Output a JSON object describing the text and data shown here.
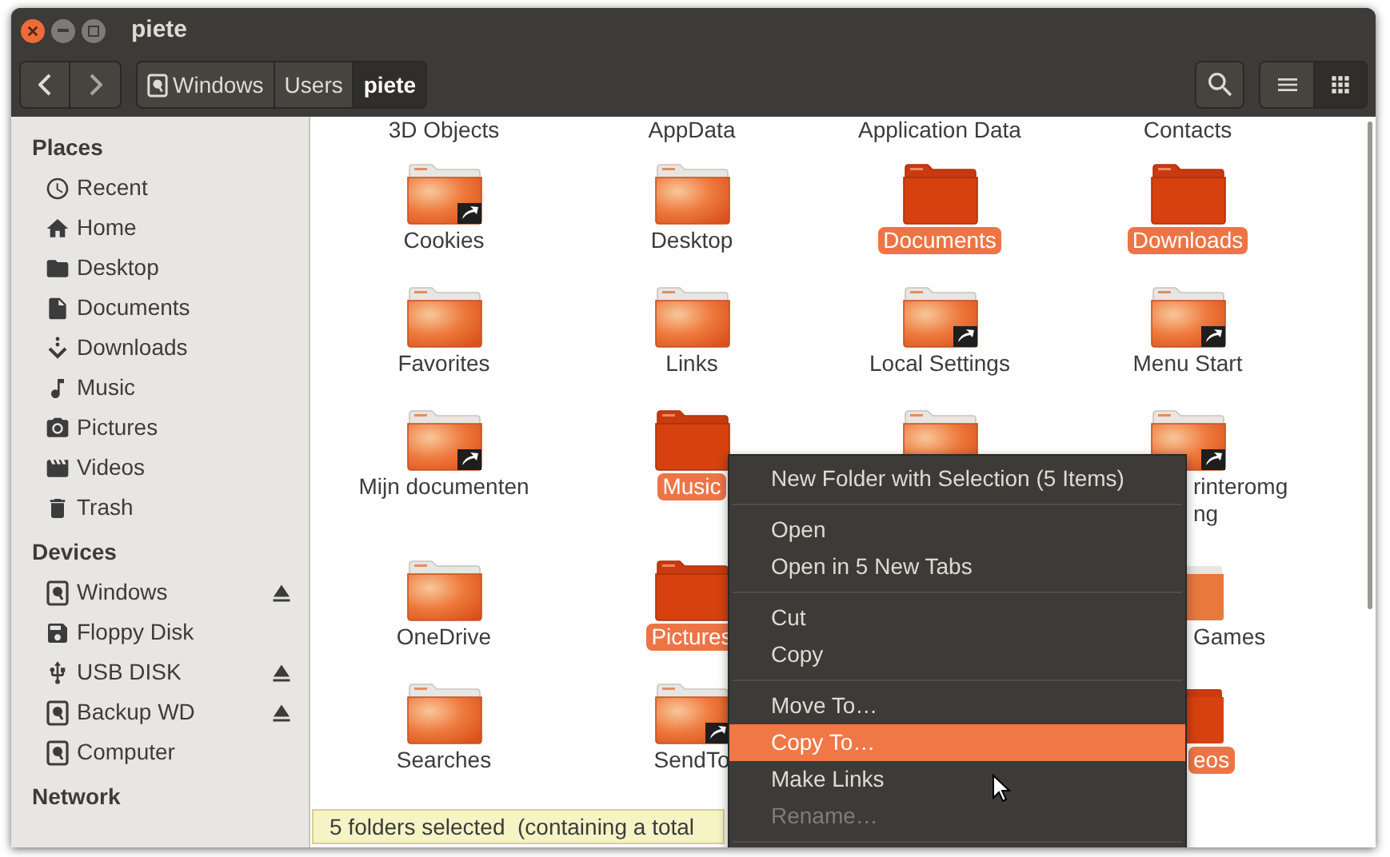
{
  "window": {
    "title": "piete"
  },
  "toolbar": {
    "breadcrumbs": [
      {
        "label": "Windows",
        "drive": true,
        "selected": false
      },
      {
        "label": "Users",
        "drive": false,
        "selected": false
      },
      {
        "label": "piete",
        "drive": false,
        "selected": true
      }
    ],
    "views": [
      {
        "kind": "list",
        "selected": false
      },
      {
        "kind": "grid",
        "selected": true
      }
    ]
  },
  "sidebar": [
    {
      "title": "Places",
      "items": [
        {
          "label": "Recent",
          "eject": false
        },
        {
          "label": "Home",
          "eject": false
        },
        {
          "label": "Desktop",
          "eject": false
        },
        {
          "label": "Documents",
          "eject": false
        },
        {
          "label": "Downloads",
          "eject": false
        },
        {
          "label": "Music",
          "eject": false
        },
        {
          "label": "Pictures",
          "eject": false
        },
        {
          "label": "Videos",
          "eject": false
        },
        {
          "label": "Trash",
          "eject": false
        }
      ]
    },
    {
      "title": "Devices",
      "items": [
        {
          "label": "Windows",
          "eject": true
        },
        {
          "label": "Floppy Disk",
          "eject": false
        },
        {
          "label": "USB DISK",
          "eject": true
        },
        {
          "label": "Backup WD",
          "eject": true
        },
        {
          "label": "Computer",
          "eject": false
        }
      ]
    },
    {
      "title": "Network"
    }
  ],
  "grid_rows": [
    [
      {
        "label": "3D Objects",
        "icon_visible": false,
        "selected": false,
        "clipped": false
      },
      {
        "label": "AppData",
        "icon_visible": false,
        "selected": false,
        "clipped": false
      },
      {
        "label": "Application Data",
        "icon_visible": false,
        "selected": false,
        "clipped": false
      },
      {
        "label": "Contacts",
        "icon_visible": false,
        "selected": false,
        "clipped": false
      }
    ],
    [
      {
        "label": "Cookies",
        "icon_visible": true,
        "link": true,
        "selected": false,
        "clipped": false
      },
      {
        "label": "Desktop",
        "icon_visible": true,
        "link": false,
        "selected": false,
        "clipped": false
      },
      {
        "label": "Documents",
        "icon_visible": true,
        "link": false,
        "selected": true,
        "clipped": false
      },
      {
        "label": "Downloads",
        "icon_visible": true,
        "link": false,
        "selected": true,
        "clipped": false
      }
    ],
    [
      {
        "label": "Favorites",
        "icon_visible": true,
        "link": false,
        "selected": false,
        "clipped": false
      },
      {
        "label": "Links",
        "icon_visible": true,
        "link": false,
        "selected": false,
        "clipped": false
      },
      {
        "label": "Local Settings",
        "icon_visible": true,
        "link": true,
        "selected": false,
        "clipped": false
      },
      {
        "label": "Menu Start",
        "icon_visible": true,
        "link": true,
        "selected": false,
        "clipped": false
      }
    ],
    [
      {
        "label": "Mijn documenten",
        "icon_visible": true,
        "link": true,
        "selected": false,
        "clipped": false
      },
      {
        "label": "Music",
        "icon_visible": true,
        "link": false,
        "selected": true,
        "clipped": false
      },
      {
        "icon_visible": true,
        "link": false,
        "clipped": false
      },
      {
        "label": "rinteromg\nng",
        "icon_visible": true,
        "link": true,
        "selected": false,
        "clipped": true
      }
    ],
    [
      {
        "label": "OneDrive",
        "icon_visible": true,
        "link": false,
        "selected": false,
        "clipped": false
      },
      {
        "label": "Pictures",
        "icon_visible": true,
        "link": false,
        "selected": true,
        "clipped": false
      },
      null,
      {
        "label": "Games",
        "icon_visible": true,
        "link": false,
        "selected": false,
        "clipped": true
      }
    ],
    [
      {
        "label": "Searches",
        "icon_visible": true,
        "link": false,
        "selected": false,
        "clipped": false
      },
      {
        "label": "SendTo",
        "icon_visible": true,
        "link": true,
        "selected": false,
        "clipped": false
      },
      null,
      {
        "label": "eos",
        "icon_visible": true,
        "link": false,
        "selected": true,
        "clipped": true
      }
    ]
  ],
  "status_bar": "5 folders selected  (containing a total",
  "context_menu": [
    {
      "kind": "item",
      "label": "New Folder with Selection (5 Items)",
      "selected": false,
      "disabled": false
    },
    {
      "kind": "separator"
    },
    {
      "kind": "item",
      "label": "Open",
      "selected": false,
      "disabled": false
    },
    {
      "kind": "item",
      "label": "Open in 5 New Tabs",
      "selected": false,
      "disabled": false
    },
    {
      "kind": "separator"
    },
    {
      "kind": "item",
      "label": "Cut",
      "selected": false,
      "disabled": false
    },
    {
      "kind": "item",
      "label": "Copy",
      "selected": false,
      "disabled": false
    },
    {
      "kind": "separator"
    },
    {
      "kind": "item",
      "label": "Move To…",
      "selected": false,
      "disabled": false
    },
    {
      "kind": "item",
      "label": "Copy To…",
      "selected": true,
      "disabled": false
    },
    {
      "kind": "item",
      "label": "Make Links",
      "selected": false,
      "disabled": false
    },
    {
      "kind": "item",
      "label": "Rename…",
      "selected": false,
      "disabled": true
    },
    {
      "kind": "separator"
    }
  ]
}
